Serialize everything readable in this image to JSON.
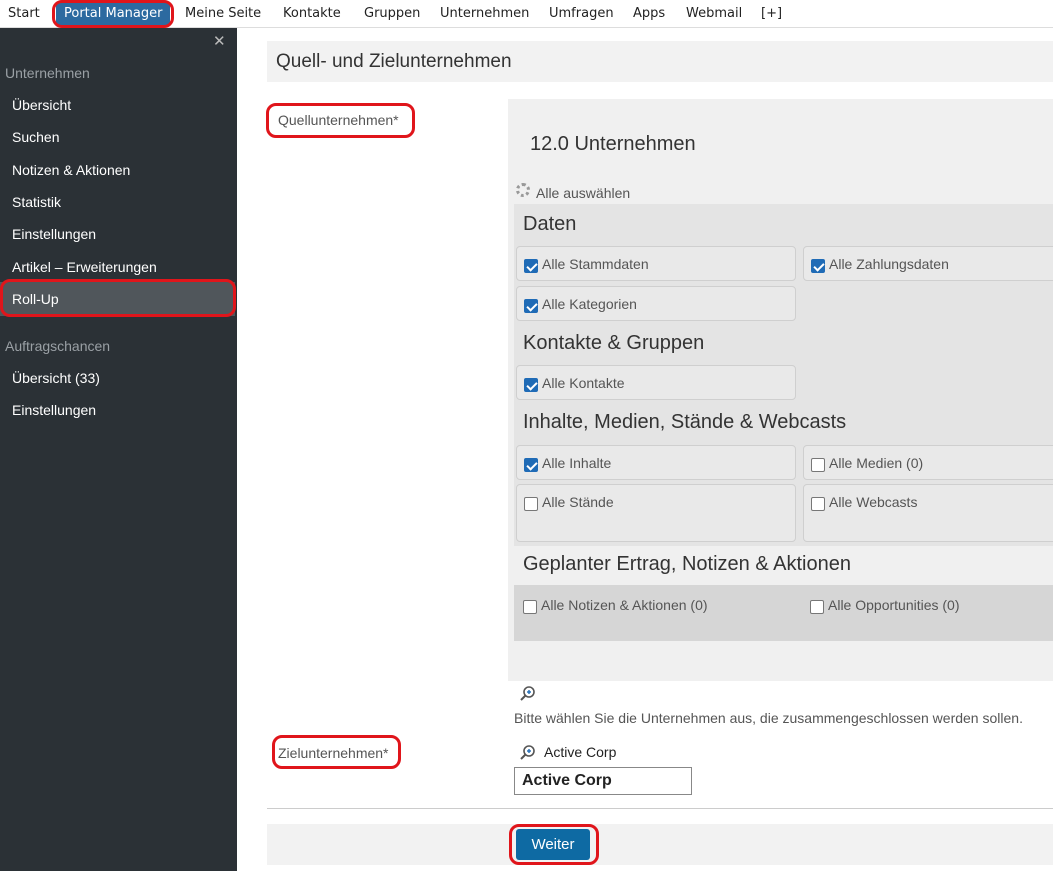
{
  "nav": {
    "items": [
      "Start",
      "Portal Manager",
      "Meine Seite",
      "Kontakte",
      "Gruppen",
      "Unternehmen",
      "Umfragen",
      "Apps",
      "Webmail",
      "[+]"
    ],
    "active": "Portal Manager"
  },
  "sidebar": {
    "close": "✕",
    "section1": "Unternehmen",
    "items1": [
      "Übersicht",
      "Suchen",
      "Notizen & Aktionen",
      "Statistik",
      "Einstellungen",
      "Artikel – Erweiterungen",
      "Roll-Up"
    ],
    "section2": "Auftragschancen",
    "items2": [
      "Übersicht (33)",
      "Einstellungen"
    ]
  },
  "page": {
    "title": "Quell- und Zielunternehmen",
    "source_label": "Quellunternehmen*",
    "target_label": "Zielunternehmen*",
    "panel_title": "12.0 Unternehmen",
    "select_all": "Alle auswählen",
    "sections": {
      "daten": "Daten",
      "kontakte": "Kontakte & Gruppen",
      "inhalte": "Inhalte, Medien, Stände & Webcasts",
      "ertrag": "Geplanter Ertrag, Notizen & Aktionen"
    },
    "options": {
      "stammdaten": "Alle Stammdaten",
      "zahlungsdaten": "Alle Zahlungsdaten",
      "kategorien": "Alle Kategorien",
      "kontakte": "Alle Kontakte",
      "inhalte": "Alle Inhalte",
      "medien": "Alle Medien (0)",
      "staende": "Alle Stände",
      "webcasts": "Alle Webcasts",
      "notizen": "Alle Notizen & Aktionen (0)",
      "opportunities": "Alle Opportunities (0)"
    },
    "hint": "Bitte wählen Sie die Unternehmen aus, die zusammengeschlossen werden sollen.",
    "target_value": "Active Corp",
    "suggestion": "Active Corp",
    "weiter": "Weiter"
  },
  "colors": {
    "accent": "#0e6aa3",
    "highlight": "#e0151b",
    "sidebar": "#2b3136"
  }
}
